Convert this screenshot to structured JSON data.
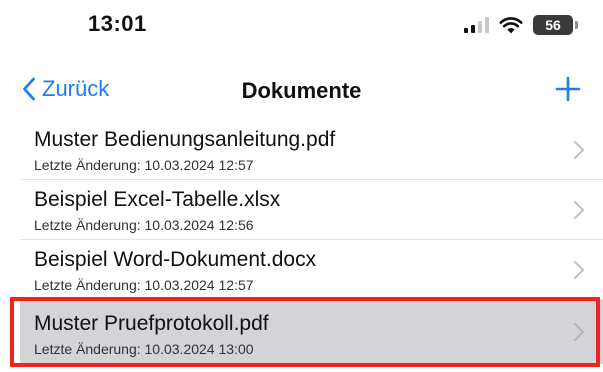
{
  "status_bar": {
    "time": "13:01",
    "battery_level": "56",
    "icons": [
      "cellular-signal-icon",
      "wifi-icon",
      "battery-icon"
    ]
  },
  "nav": {
    "back_label": "Zurück",
    "title": "Dokumente",
    "add_icon": "plus-icon",
    "accent_color": "#1e7cf2"
  },
  "documents": [
    {
      "name": "Muster Bedienungsanleitung.pdf",
      "modified": "Letzte Änderung: 10.03.2024 12:57",
      "selected": false
    },
    {
      "name": "Beispiel Excel-Tabelle.xlsx",
      "modified": "Letzte Änderung: 10.03.2024 12:56",
      "selected": false
    },
    {
      "name": "Beispiel Word-Dokument.docx",
      "modified": "Letzte Änderung: 10.03.2024 12:57",
      "selected": false
    },
    {
      "name": "Muster Pruefprotokoll.pdf",
      "modified": "Letzte Änderung: 10.03.2024 13:00",
      "selected": true
    }
  ],
  "highlight_color": "#f0241a",
  "selected_row_color": "#d3d3d8"
}
